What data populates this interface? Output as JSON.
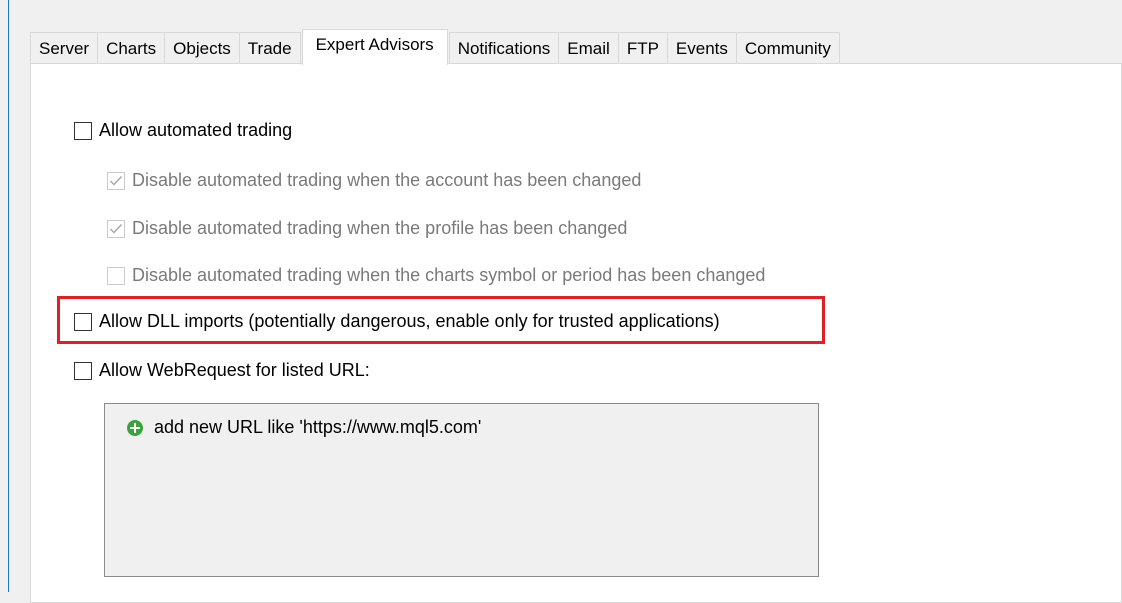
{
  "tabs": [
    {
      "label": "Server",
      "active": false
    },
    {
      "label": "Charts",
      "active": false
    },
    {
      "label": "Objects",
      "active": false
    },
    {
      "label": "Trade",
      "active": false
    },
    {
      "label": "Expert Advisors",
      "active": true
    },
    {
      "label": "Notifications",
      "active": false
    },
    {
      "label": "Email",
      "active": false
    },
    {
      "label": "FTP",
      "active": false
    },
    {
      "label": "Events",
      "active": false
    },
    {
      "label": "Community",
      "active": false
    }
  ],
  "options": {
    "allow_automated_trading": {
      "label": "Allow automated trading",
      "checked": false,
      "enabled": true
    },
    "disable_on_account_change": {
      "label": "Disable automated trading when the account has been changed",
      "checked": true,
      "enabled": false
    },
    "disable_on_profile_change": {
      "label": "Disable automated trading when the profile has been changed",
      "checked": true,
      "enabled": false
    },
    "disable_on_symbol_period_change": {
      "label": "Disable automated trading when the charts symbol or period has been changed",
      "checked": false,
      "enabled": false
    },
    "allow_dll_imports": {
      "label": "Allow DLL imports (potentially dangerous, enable only for trusted applications)",
      "checked": false,
      "enabled": true,
      "highlighted": true
    },
    "allow_webrequest": {
      "label": "Allow WebRequest for listed URL:",
      "checked": false,
      "enabled": true
    }
  },
  "url_list": {
    "add_label": "add new URL like 'https://www.mql5.com'",
    "add_icon": "plus-circle-icon"
  },
  "colors": {
    "highlight_border": "#e21f26",
    "add_icon": "#3aa43a",
    "window_accent": "#1e72c8"
  }
}
